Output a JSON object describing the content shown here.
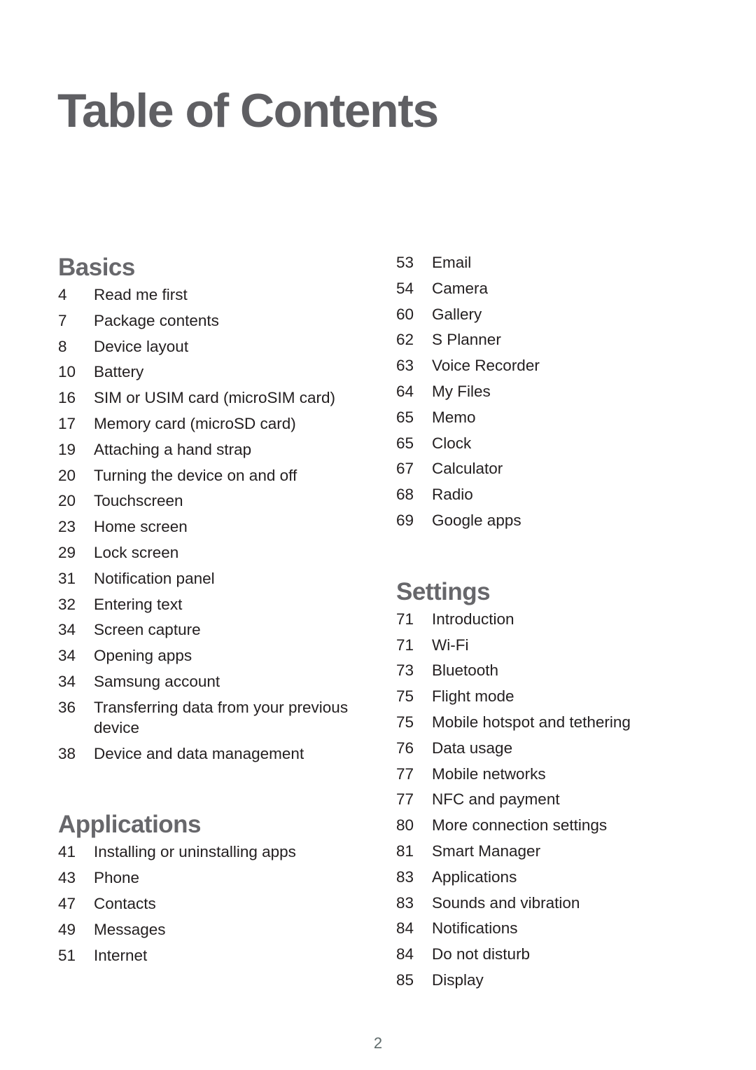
{
  "title": "Table of Contents",
  "page_number": "2",
  "colors": {
    "title": "#5f5f63",
    "heading": "#67676b",
    "body_text": "#231f20"
  },
  "sections": {
    "basics": {
      "heading": "Basics",
      "items": [
        {
          "page": "4",
          "label": "Read me first"
        },
        {
          "page": "7",
          "label": "Package contents"
        },
        {
          "page": "8",
          "label": "Device layout"
        },
        {
          "page": "10",
          "label": "Battery"
        },
        {
          "page": "16",
          "label": "SIM or USIM card (microSIM card)"
        },
        {
          "page": "17",
          "label": "Memory card (microSD card)"
        },
        {
          "page": "19",
          "label": "Attaching a hand strap"
        },
        {
          "page": "20",
          "label": "Turning the device on and off"
        },
        {
          "page": "20",
          "label": "Touchscreen"
        },
        {
          "page": "23",
          "label": "Home screen"
        },
        {
          "page": "29",
          "label": "Lock screen"
        },
        {
          "page": "31",
          "label": "Notification panel"
        },
        {
          "page": "32",
          "label": "Entering text"
        },
        {
          "page": "34",
          "label": "Screen capture"
        },
        {
          "page": "34",
          "label": "Opening apps"
        },
        {
          "page": "34",
          "label": "Samsung account"
        },
        {
          "page": "36",
          "label": "Transferring data from your previous device"
        },
        {
          "page": "38",
          "label": "Device and data management"
        }
      ]
    },
    "applications": {
      "heading": "Applications",
      "items": [
        {
          "page": "41",
          "label": "Installing or uninstalling apps"
        },
        {
          "page": "43",
          "label": "Phone"
        },
        {
          "page": "47",
          "label": "Contacts"
        },
        {
          "page": "49",
          "label": "Messages"
        },
        {
          "page": "51",
          "label": "Internet"
        },
        {
          "page": "53",
          "label": "Email"
        },
        {
          "page": "54",
          "label": "Camera"
        },
        {
          "page": "60",
          "label": "Gallery"
        },
        {
          "page": "62",
          "label": "S Planner"
        },
        {
          "page": "63",
          "label": "Voice Recorder"
        },
        {
          "page": "64",
          "label": "My Files"
        },
        {
          "page": "65",
          "label": "Memo"
        },
        {
          "page": "65",
          "label": "Clock"
        },
        {
          "page": "67",
          "label": "Calculator"
        },
        {
          "page": "68",
          "label": "Radio"
        },
        {
          "page": "69",
          "label": "Google apps"
        }
      ]
    },
    "settings": {
      "heading": "Settings",
      "items": [
        {
          "page": "71",
          "label": "Introduction"
        },
        {
          "page": "71",
          "label": "Wi-Fi"
        },
        {
          "page": "73",
          "label": "Bluetooth"
        },
        {
          "page": "75",
          "label": "Flight mode"
        },
        {
          "page": "75",
          "label": "Mobile hotspot and tethering"
        },
        {
          "page": "76",
          "label": "Data usage"
        },
        {
          "page": "77",
          "label": "Mobile networks"
        },
        {
          "page": "77",
          "label": "NFC and payment"
        },
        {
          "page": "80",
          "label": "More connection settings"
        },
        {
          "page": "81",
          "label": "Smart Manager"
        },
        {
          "page": "83",
          "label": "Applications"
        },
        {
          "page": "83",
          "label": "Sounds and vibration"
        },
        {
          "page": "84",
          "label": "Notifications"
        },
        {
          "page": "84",
          "label": "Do not disturb"
        },
        {
          "page": "85",
          "label": "Display"
        }
      ]
    }
  }
}
